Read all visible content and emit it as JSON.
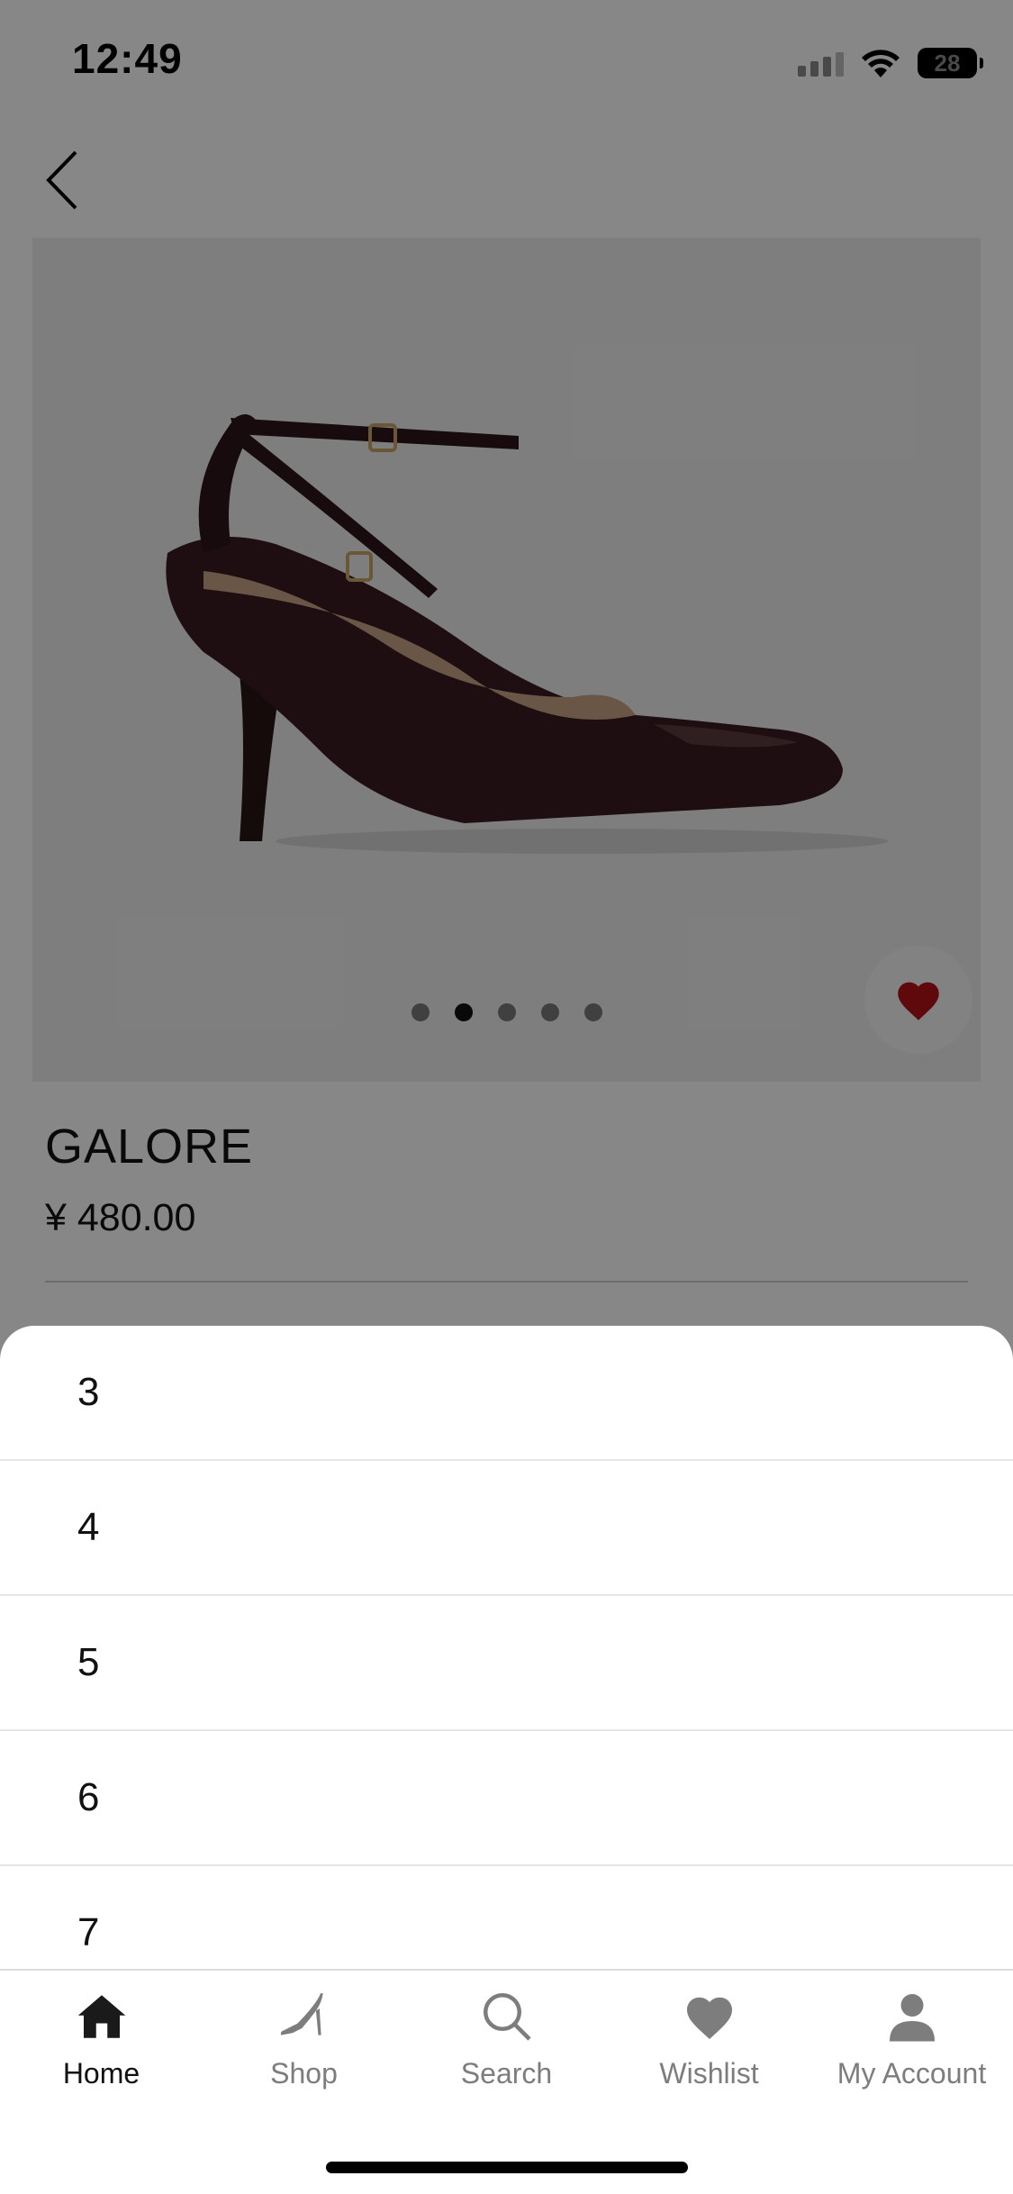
{
  "status_bar": {
    "time": "12:49",
    "battery": "28"
  },
  "product": {
    "name": "GALORE",
    "price": "¥ 480.00",
    "image_count": 5,
    "active_image_index": 1,
    "wishlisted": true
  },
  "size_sheet": {
    "options": [
      "3",
      "4",
      "5",
      "6",
      "7"
    ]
  },
  "tab_bar": {
    "tabs": [
      {
        "label": "Home",
        "icon": "home-icon",
        "active": true
      },
      {
        "label": "Shop",
        "icon": "high-heel-icon",
        "active": false
      },
      {
        "label": "Search",
        "icon": "search-icon",
        "active": false
      },
      {
        "label": "Wishlist",
        "icon": "heart-icon",
        "active": false
      },
      {
        "label": "My Account",
        "icon": "account-icon",
        "active": false
      }
    ]
  },
  "colors": {
    "overlay": "#000000",
    "heart": "#b3121a",
    "text": "#111111",
    "inactive_tab": "#7d7d7d"
  }
}
